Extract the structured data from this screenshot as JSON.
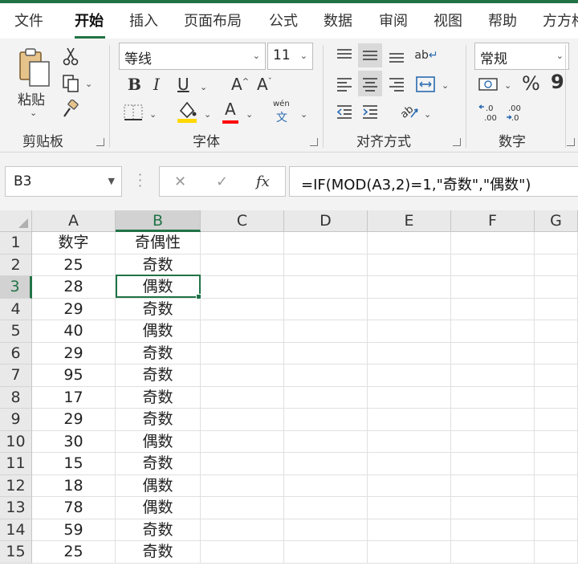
{
  "ribbon_tabs": [
    "文件",
    "开始",
    "插入",
    "页面布局",
    "公式",
    "数据",
    "审阅",
    "视图",
    "帮助",
    "方方格"
  ],
  "active_tab": "开始",
  "clipboard": {
    "paste_label": "粘贴",
    "group_label": "剪贴板"
  },
  "font": {
    "family": "等线",
    "size": "11",
    "bold": "B",
    "italic": "I",
    "underline": "U",
    "grow": "A",
    "shrink": "A",
    "font_color_glyph": "A",
    "phonetic_top": "wén",
    "phonetic_bottom": "文",
    "group_label": "字体"
  },
  "alignment": {
    "group_label": "对齐方式",
    "wrap_glyph": "ab"
  },
  "number": {
    "format": "常规",
    "percent": "%",
    "comma": "9",
    "group_label": "数字"
  },
  "formula_bar": {
    "name_box": "B3",
    "cancel": "✕",
    "confirm": "✓",
    "fx": "fx",
    "formula": "=IF(MOD(A3,2)=1,\"奇数\",\"偶数\")"
  },
  "sheet": {
    "columns": [
      "A",
      "B",
      "C",
      "D",
      "E",
      "F",
      "G"
    ],
    "rows": [
      {
        "num": "1",
        "a": "数字",
        "b": "奇偶性"
      },
      {
        "num": "2",
        "a": "25",
        "b": "奇数"
      },
      {
        "num": "3",
        "a": "28",
        "b": "偶数"
      },
      {
        "num": "4",
        "a": "29",
        "b": "奇数"
      },
      {
        "num": "5",
        "a": "40",
        "b": "偶数"
      },
      {
        "num": "6",
        "a": "29",
        "b": "奇数"
      },
      {
        "num": "7",
        "a": "95",
        "b": "奇数"
      },
      {
        "num": "8",
        "a": "17",
        "b": "奇数"
      },
      {
        "num": "9",
        "a": "29",
        "b": "奇数"
      },
      {
        "num": "10",
        "a": "30",
        "b": "偶数"
      },
      {
        "num": "11",
        "a": "15",
        "b": "奇数"
      },
      {
        "num": "12",
        "a": "18",
        "b": "偶数"
      },
      {
        "num": "13",
        "a": "78",
        "b": "偶数"
      },
      {
        "num": "14",
        "a": "59",
        "b": "奇数"
      },
      {
        "num": "15",
        "a": "25",
        "b": "奇数"
      }
    ]
  },
  "colors": {
    "accent": "#217346",
    "fill_highlight": "#ffd800"
  }
}
